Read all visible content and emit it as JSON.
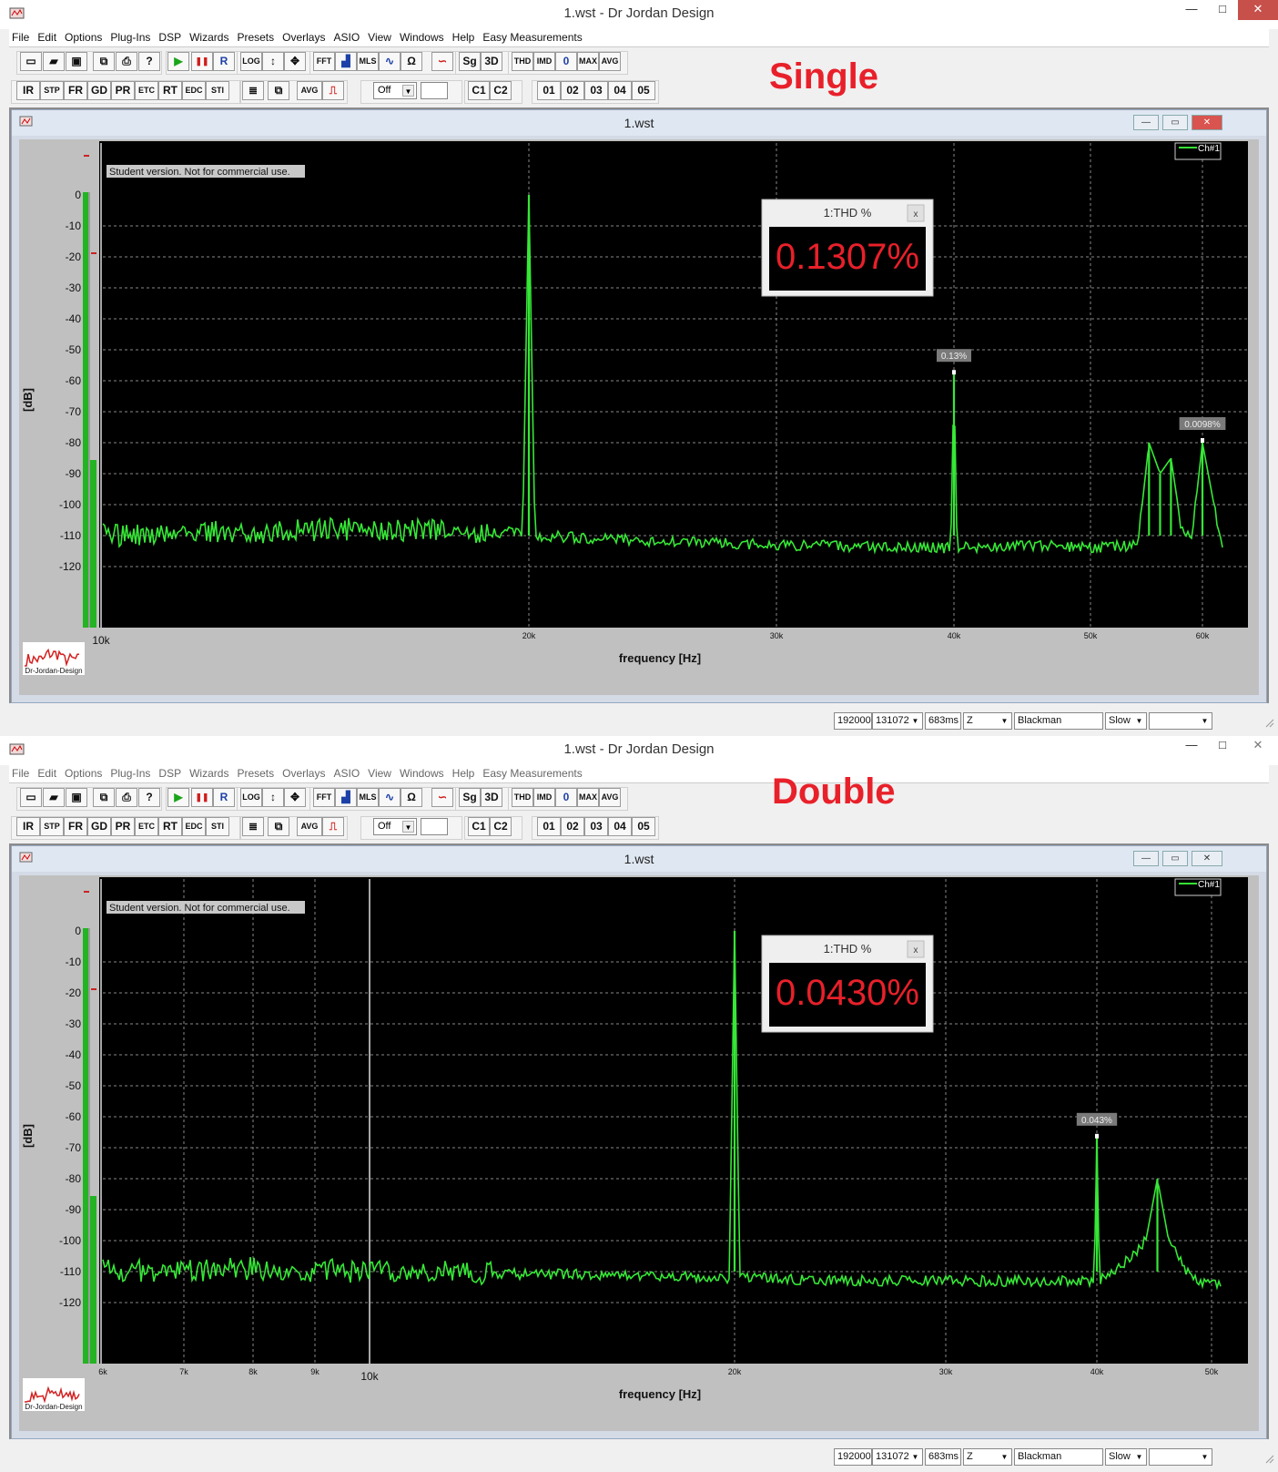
{
  "menu": [
    "File",
    "Edit",
    "Options",
    "Plug-Ins",
    "DSP",
    "Wizards",
    "Presets",
    "Overlays",
    "ASIO",
    "View",
    "Windows",
    "Help",
    "Easy Measurements"
  ],
  "toolbar1": {
    "io": [
      "",
      "",
      "",
      "",
      ""
    ],
    "run": [
      "▶",
      "❚❚",
      "R"
    ],
    "nav": [
      "LOG",
      "↕",
      "✥"
    ],
    "modes": [
      "FFT",
      "",
      "MLS",
      "",
      "Ω"
    ],
    "misc": [
      "Sg",
      "3D"
    ],
    "meas": [
      "THD",
      "IMD",
      "0",
      "MAX",
      "AVG"
    ]
  },
  "toolbar2": {
    "analysis": [
      "IR",
      "STP",
      "FR",
      "GD",
      "PR",
      "ETC",
      "RT",
      "EDC",
      "STI"
    ],
    "avg_label": "AVG",
    "off_value": "Off",
    "channels": [
      "C1",
      "C2"
    ],
    "presets": [
      "01",
      "02",
      "03",
      "04",
      "05"
    ]
  },
  "windows": [
    {
      "label": "Single",
      "app_title": "1.wst - Dr Jordan Design",
      "child_title": "1.wst",
      "plot": {
        "student_note": "Student version. Not for commercial use.",
        "ylabel": "[dB]",
        "xlabel": "frequency [Hz]",
        "legend": "Ch#1",
        "logo": "Dr-Jordan-Design",
        "yticks": [
          "0",
          "-10",
          "-20",
          "-30",
          "-40",
          "-50",
          "-60",
          "-70",
          "-80",
          "-90",
          "-100",
          "-110",
          "-120"
        ],
        "xticks": [
          "10k",
          "20k",
          "30k",
          "40k",
          "50k",
          "60k"
        ],
        "thd_title": "1:THD %",
        "thd_value": "0.1307%",
        "thd_close": "x",
        "markers": [
          "0.13%",
          "0.0098%"
        ]
      },
      "status": [
        "192000",
        "131072",
        "683ms",
        "Z",
        "Blackman",
        "Slow",
        ""
      ]
    },
    {
      "label": "Double",
      "app_title": "1.wst - Dr Jordan Design",
      "child_title": "1.wst",
      "plot": {
        "student_note": "Student version. Not for commercial use.",
        "ylabel": "[dB]",
        "xlabel": "frequency [Hz]",
        "legend": "Ch#1",
        "logo": "Dr-Jordan-Design",
        "yticks": [
          "0",
          "-10",
          "-20",
          "-30",
          "-40",
          "-50",
          "-60",
          "-70",
          "-80",
          "-90",
          "-100",
          "-110",
          "-120"
        ],
        "xticks": [
          "6k",
          "7k",
          "8k",
          "9k",
          "10k",
          "20k",
          "30k",
          "40k",
          "50k"
        ],
        "thd_title": "1:THD %",
        "thd_value": "0.0430%",
        "thd_close": "x",
        "markers": [
          "0.043%"
        ]
      },
      "status": [
        "192000",
        "131072",
        "683ms",
        "Z",
        "Blackman",
        "Slow",
        ""
      ]
    }
  ],
  "chart_data": [
    {
      "type": "line",
      "title": "",
      "xlabel": "frequency [Hz]",
      "ylabel": "[dB]",
      "x_scale": "log",
      "xlim": [
        10000,
        62000
      ],
      "ylim": [
        -135,
        2
      ],
      "series": [
        {
          "name": "Ch#1",
          "x": [
            10000,
            15000,
            19800,
            20000,
            20200,
            25000,
            30000,
            39800,
            40000,
            40200,
            45000,
            50000,
            54000,
            55000,
            56000,
            57000,
            58000,
            59000,
            60000,
            62000
          ],
          "y": [
            -110,
            -108,
            -109,
            0,
            -110,
            -112,
            -113,
            -114,
            -58,
            -114,
            -113,
            -114,
            -113,
            -80,
            -90,
            -85,
            -108,
            -110,
            -80,
            -115
          ]
        }
      ],
      "annotations": [
        {
          "text": "0.13%",
          "x": 40000,
          "y": -58
        },
        {
          "text": "0.0098%",
          "x": 60000,
          "y": -80
        }
      ],
      "grid": true
    },
    {
      "type": "line",
      "title": "",
      "xlabel": "frequency [Hz]",
      "ylabel": "[dB]",
      "x_scale": "log",
      "xlim": [
        5900,
        51000
      ],
      "ylim": [
        -135,
        2
      ],
      "series": [
        {
          "name": "Ch#1",
          "x": [
            5900,
            8000,
            10000,
            15000,
            19800,
            20000,
            20200,
            25000,
            30000,
            39800,
            40000,
            40200,
            42000,
            44000,
            45000,
            46000,
            48000,
            51000
          ],
          "y": [
            -110,
            -109,
            -110,
            -111,
            -112,
            0,
            -112,
            -113,
            -113,
            -113,
            -67,
            -113,
            -108,
            -100,
            -80,
            -100,
            -112,
            -115
          ]
        }
      ],
      "annotations": [
        {
          "text": "0.043%",
          "x": 40000,
          "y": -67
        }
      ],
      "grid": true
    }
  ]
}
